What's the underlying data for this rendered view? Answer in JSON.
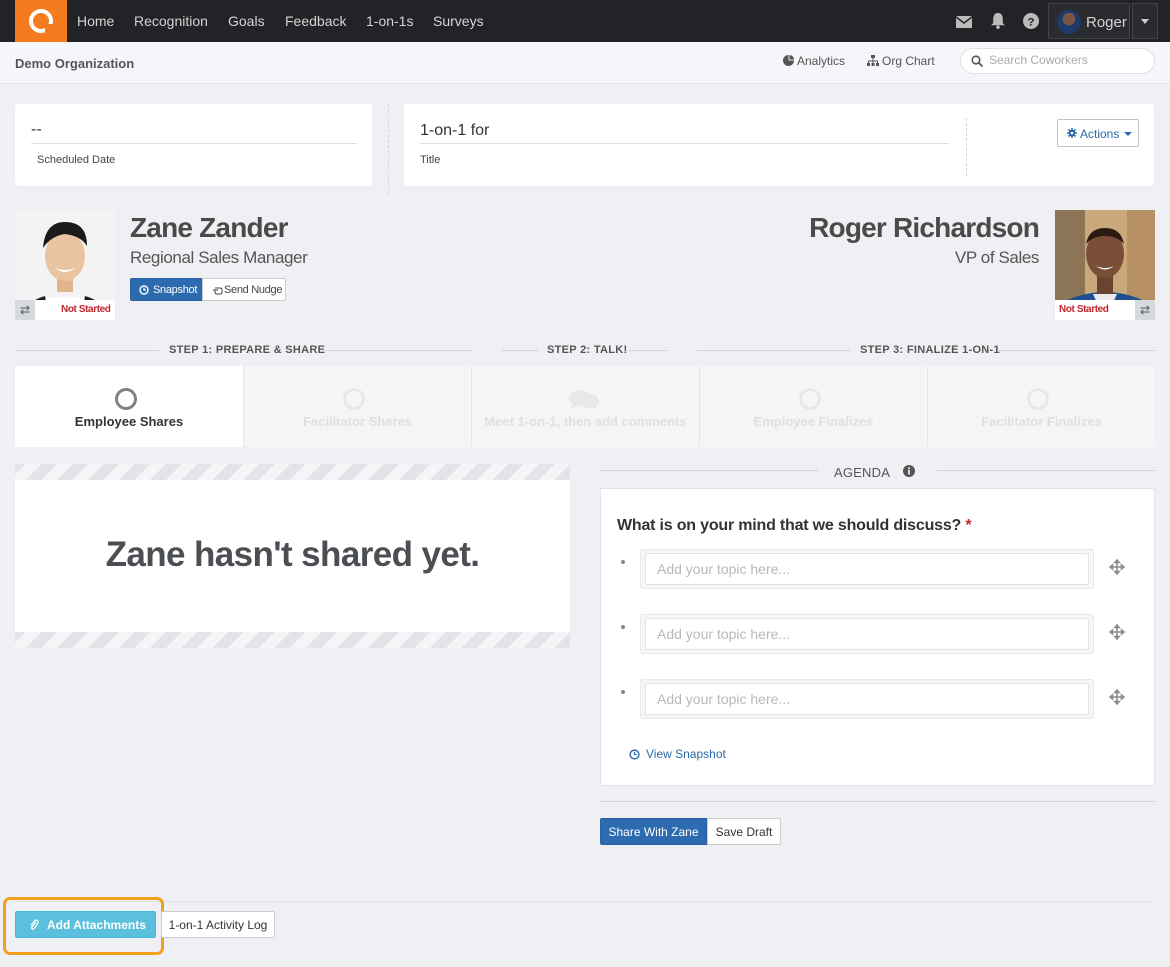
{
  "nav": {
    "links": [
      "Home",
      "Recognition",
      "Goals",
      "Feedback",
      "1-on-1s",
      "Surveys"
    ],
    "user_name": "Roger"
  },
  "subheader": {
    "org": "Demo Organization",
    "analytics": "Analytics",
    "org_chart": "Org Chart",
    "search_placeholder": "Search Coworkers"
  },
  "meeting": {
    "scheduled_value": "--",
    "scheduled_label": "Scheduled Date",
    "title_value": "1-on-1 for",
    "title_label": "Title",
    "actions_label": "Actions"
  },
  "employee": {
    "name": "Zane Zander",
    "title": "Regional Sales Manager",
    "status": "Not Started",
    "snapshot_btn": "Snapshot",
    "nudge_btn": "Send Nudge"
  },
  "facilitator": {
    "name": "Roger Richardson",
    "title": "VP of Sales",
    "status": "Not Started"
  },
  "steps": {
    "headers": [
      "STEP 1: PREPARE & SHARE",
      "STEP 2: TALK!",
      "STEP 3: FINALIZE 1-ON-1"
    ],
    "tabs": [
      "Employee Shares",
      "Facilitator Shares",
      "Meet 1-on-1, then add comments",
      "Employee Finalizes",
      "Facilitator Finalizes"
    ],
    "active_tab": 0
  },
  "not_shared_msg": "Zane hasn't shared yet.",
  "agenda": {
    "header": "AGENDA",
    "question": "What is on your mind that we should discuss?",
    "required_mark": "*",
    "topic_placeholder": "Add your topic here...",
    "topics": [
      "",
      "",
      ""
    ],
    "view_snapshot": "View Snapshot"
  },
  "actions": {
    "share": "Share With Zane",
    "save_draft": "Save Draft",
    "add_attachments": "Add Attachments",
    "activity_log": "1-on-1 Activity Log"
  },
  "colors": {
    "brand": "#f47b20",
    "primary": "#2c6bb0",
    "info": "#5bc0de",
    "highlight": "#f2a11c",
    "status_red": "#c0262d"
  }
}
